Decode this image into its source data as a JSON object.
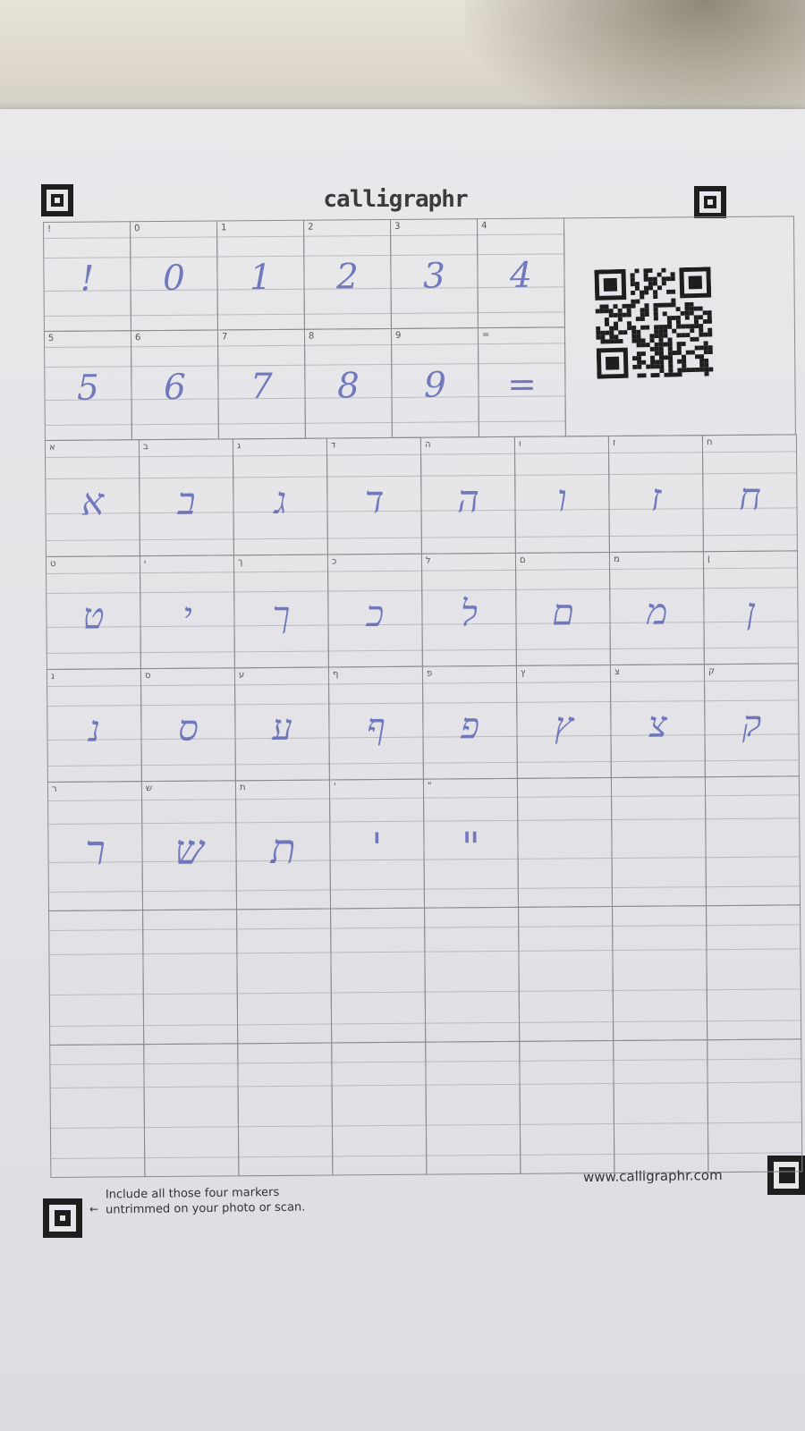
{
  "brand": "calligraphr",
  "footer": {
    "note_line1": "Include all those four markers",
    "note_line2": "untrimmed on your photo or scan.",
    "arrow": "←",
    "url": "www.calligraphr.com"
  },
  "rows": [
    {
      "cells": [
        {
          "label": "!",
          "glyph": "!"
        },
        {
          "label": "0",
          "glyph": "0"
        },
        {
          "label": "1",
          "glyph": "1"
        },
        {
          "label": "2",
          "glyph": "2"
        },
        {
          "label": "3",
          "glyph": "3"
        },
        {
          "label": "4",
          "glyph": "4"
        }
      ]
    },
    {
      "cells": [
        {
          "label": "5",
          "glyph": "5"
        },
        {
          "label": "6",
          "glyph": "6"
        },
        {
          "label": "7",
          "glyph": "7"
        },
        {
          "label": "8",
          "glyph": "8"
        },
        {
          "label": "9",
          "glyph": "9"
        },
        {
          "label": "=",
          "glyph": "="
        }
      ]
    },
    {
      "cells": [
        {
          "label": "א",
          "glyph": "א"
        },
        {
          "label": "ב",
          "glyph": "ב"
        },
        {
          "label": "ג",
          "glyph": "ג"
        },
        {
          "label": "ד",
          "glyph": "ד"
        },
        {
          "label": "ה",
          "glyph": "ה"
        },
        {
          "label": "ו",
          "glyph": "ו"
        },
        {
          "label": "ז",
          "glyph": "ז"
        },
        {
          "label": "ח",
          "glyph": "ח"
        }
      ]
    },
    {
      "cells": [
        {
          "label": "ט",
          "glyph": "ט"
        },
        {
          "label": "י",
          "glyph": "י"
        },
        {
          "label": "ך",
          "glyph": "ך"
        },
        {
          "label": "כ",
          "glyph": "כ"
        },
        {
          "label": "ל",
          "glyph": "ל"
        },
        {
          "label": "ם",
          "glyph": "ם"
        },
        {
          "label": "מ",
          "glyph": "מ"
        },
        {
          "label": "ן",
          "glyph": "ן"
        }
      ]
    },
    {
      "cells": [
        {
          "label": "נ",
          "glyph": "נ"
        },
        {
          "label": "ס",
          "glyph": "ס"
        },
        {
          "label": "ע",
          "glyph": "ע"
        },
        {
          "label": "ף",
          "glyph": "ף"
        },
        {
          "label": "פ",
          "glyph": "פ"
        },
        {
          "label": "ץ",
          "glyph": "ץ"
        },
        {
          "label": "צ",
          "glyph": "צ"
        },
        {
          "label": "ק",
          "glyph": "ק"
        }
      ]
    },
    {
      "cells": [
        {
          "label": "ר",
          "glyph": "ר"
        },
        {
          "label": "ש",
          "glyph": "ש"
        },
        {
          "label": "ת",
          "glyph": "ת"
        },
        {
          "label": "'",
          "glyph": "'"
        },
        {
          "label": "\"",
          "glyph": "\""
        },
        {
          "label": "",
          "glyph": ""
        },
        {
          "label": "",
          "glyph": ""
        },
        {
          "label": "",
          "glyph": ""
        }
      ]
    },
    {
      "cells": [
        {
          "label": "",
          "glyph": ""
        },
        {
          "label": "",
          "glyph": ""
        },
        {
          "label": "",
          "glyph": ""
        },
        {
          "label": "",
          "glyph": ""
        },
        {
          "label": "",
          "glyph": ""
        },
        {
          "label": "",
          "glyph": ""
        },
        {
          "label": "",
          "glyph": ""
        },
        {
          "label": "",
          "glyph": ""
        }
      ]
    },
    {
      "cells": [
        {
          "label": "",
          "glyph": ""
        },
        {
          "label": "",
          "glyph": ""
        },
        {
          "label": "",
          "glyph": ""
        },
        {
          "label": "",
          "glyph": ""
        },
        {
          "label": "",
          "glyph": ""
        },
        {
          "label": "",
          "glyph": ""
        },
        {
          "label": "",
          "glyph": ""
        },
        {
          "label": "",
          "glyph": ""
        }
      ]
    }
  ],
  "colors": {
    "ink": "#5d66b5",
    "paper": "#e6e6ea",
    "line": "#8a8a8f"
  }
}
